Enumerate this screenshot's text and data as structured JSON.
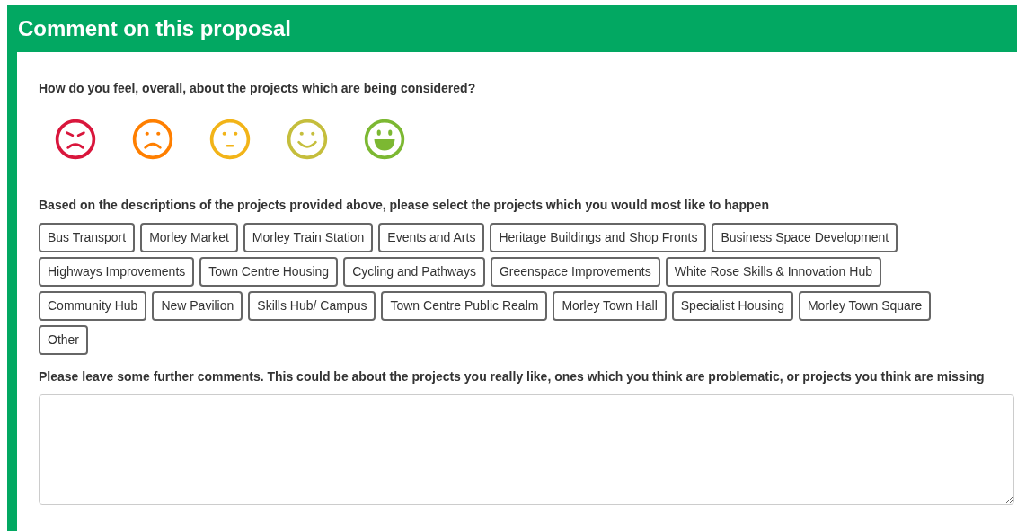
{
  "title": "Comment on this proposal",
  "feeling": {
    "question": "How do you feel, overall, about the projects which are being considered?",
    "faces": [
      {
        "kind": "angry",
        "color": "#d9163c",
        "selected": false
      },
      {
        "kind": "sad",
        "color": "#ff7f00",
        "selected": false
      },
      {
        "kind": "neutral",
        "color": "#f2b418",
        "selected": false
      },
      {
        "kind": "smile",
        "color": "#c5be3c",
        "selected": false
      },
      {
        "kind": "grin",
        "color": "#7cb832",
        "selected": false
      }
    ]
  },
  "projects": {
    "question": "Based on the descriptions of the projects provided above, please select the projects which you would most like to happen",
    "options": [
      {
        "label": "Bus Transport",
        "selected": false
      },
      {
        "label": "Morley Market",
        "selected": false
      },
      {
        "label": "Morley Train Station",
        "selected": false
      },
      {
        "label": "Events and Arts",
        "selected": false
      },
      {
        "label": "Heritage Buildings and Shop Fronts",
        "selected": false
      },
      {
        "label": "Business Space Development",
        "selected": false
      },
      {
        "label": "Highways Improvements",
        "selected": false
      },
      {
        "label": "Town Centre Housing",
        "selected": false
      },
      {
        "label": "Cycling and Pathways",
        "selected": false
      },
      {
        "label": "Greenspace Improvements",
        "selected": false
      },
      {
        "label": "White Rose Skills & Innovation Hub",
        "selected": false
      },
      {
        "label": "Community Hub",
        "selected": false
      },
      {
        "label": "New Pavilion",
        "selected": false
      },
      {
        "label": "Skills Hub/ Campus",
        "selected": false
      },
      {
        "label": "Town Centre Public Realm",
        "selected": false
      },
      {
        "label": "Morley Town Hall",
        "selected": false
      },
      {
        "label": "Specialist Housing",
        "selected": false
      },
      {
        "label": "Morley Town Square",
        "selected": false
      },
      {
        "label": "Other",
        "selected": false
      }
    ]
  },
  "comments": {
    "question": "Please leave some further comments. This could be about the projects you really like, ones which you think are problematic, or projects you think are missing"
  }
}
